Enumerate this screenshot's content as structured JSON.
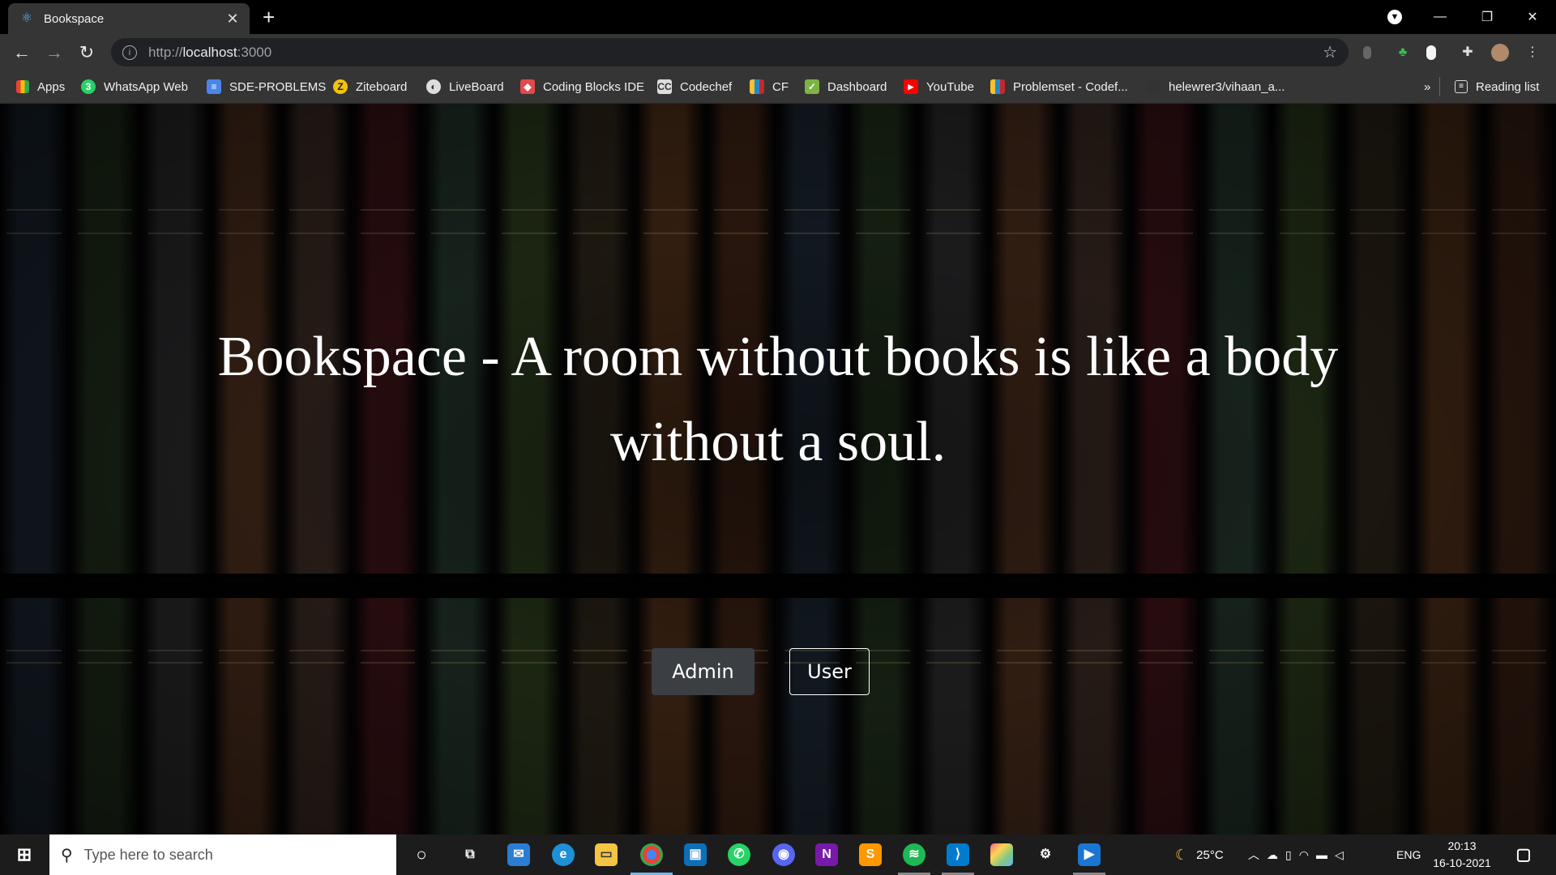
{
  "browser": {
    "tab_title": "Bookspace",
    "url_scheme": "http://",
    "url_host": "localhost",
    "url_port": ":3000",
    "reading_list": "Reading list",
    "bookmarks": [
      {
        "label": "Apps",
        "icon": "apps-grid-icon",
        "color": "#4285f4"
      },
      {
        "label": "WhatsApp Web",
        "icon": "whatsapp-icon",
        "color": "#25d366"
      },
      {
        "label": "SDE-PROBLEMS",
        "icon": "docs-icon",
        "color": "#4a86e8"
      },
      {
        "label": "Ziteboard",
        "icon": "ziteboard-icon",
        "color": "#f4c20d"
      },
      {
        "label": "LiveBoard",
        "icon": "liveboard-icon",
        "color": "#dddddd"
      },
      {
        "label": "Coding Blocks IDE",
        "icon": "coding-blocks-icon",
        "color": "#e5484d"
      },
      {
        "label": "Codechef",
        "icon": "codechef-icon",
        "color": "#8b5a2b"
      },
      {
        "label": "CF",
        "icon": "codeforces-icon",
        "color": "#1f8acb"
      },
      {
        "label": "Dashboard",
        "icon": "dashboard-icon",
        "color": "#7cb342"
      },
      {
        "label": "YouTube",
        "icon": "youtube-icon",
        "color": "#ff0000"
      },
      {
        "label": "Problemset - Codef...",
        "icon": "codeforces-icon",
        "color": "#1f8acb"
      },
      {
        "label": "helewrer3/vihaan_a...",
        "icon": "github-icon",
        "color": "#333333"
      }
    ]
  },
  "page": {
    "hero_line1": "Bookspace - A room without books is like a body",
    "hero_line2": "without a soul.",
    "admin_button": "Admin",
    "user_button": "User"
  },
  "taskbar": {
    "search_placeholder": "Type here to search",
    "temperature": "25°C",
    "language": "ENG",
    "time": "20:13",
    "date": "16-10-2021"
  }
}
